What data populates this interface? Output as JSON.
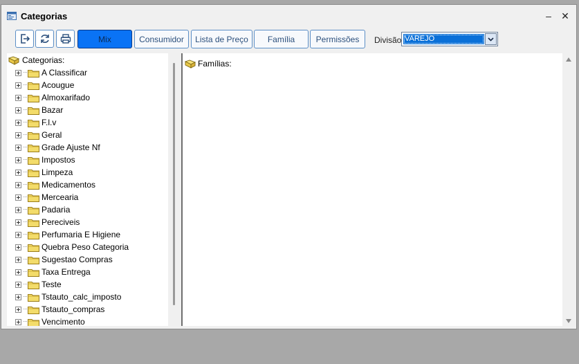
{
  "window": {
    "title": "Categorias",
    "min_glyph": "–",
    "close_glyph": "✕"
  },
  "toolbar": {
    "buttons": [
      {
        "label": "Mix",
        "active": true
      },
      {
        "label": "Consumidor"
      },
      {
        "label": "Lista de Preço"
      },
      {
        "label": "Família"
      },
      {
        "label": "Permissões"
      }
    ],
    "division_label": "Divisão",
    "division_value": "VAREJO"
  },
  "tree": {
    "root_label": "Categorias:",
    "items": [
      " A Classificar",
      "Acougue",
      "Almoxarifado",
      "Bazar",
      "F.l.v",
      "Geral",
      "Grade Ajuste Nf",
      "Impostos",
      "Limpeza",
      "Medicamentos",
      "Mercearia",
      "Padaria",
      "Pereciveis",
      "Perfumaria E Higiene",
      "Quebra Peso Categoria",
      "Sugestao Compras",
      "Taxa Entrega",
      "Teste",
      "Tstauto_calc_imposto",
      "Tstauto_compras",
      "Vencimento"
    ]
  },
  "families": {
    "root_label": "Famílias:"
  },
  "colors": {
    "active_button": "#0a73f5",
    "button_border": "#5b8ec6",
    "selection": "#0a70d8"
  }
}
